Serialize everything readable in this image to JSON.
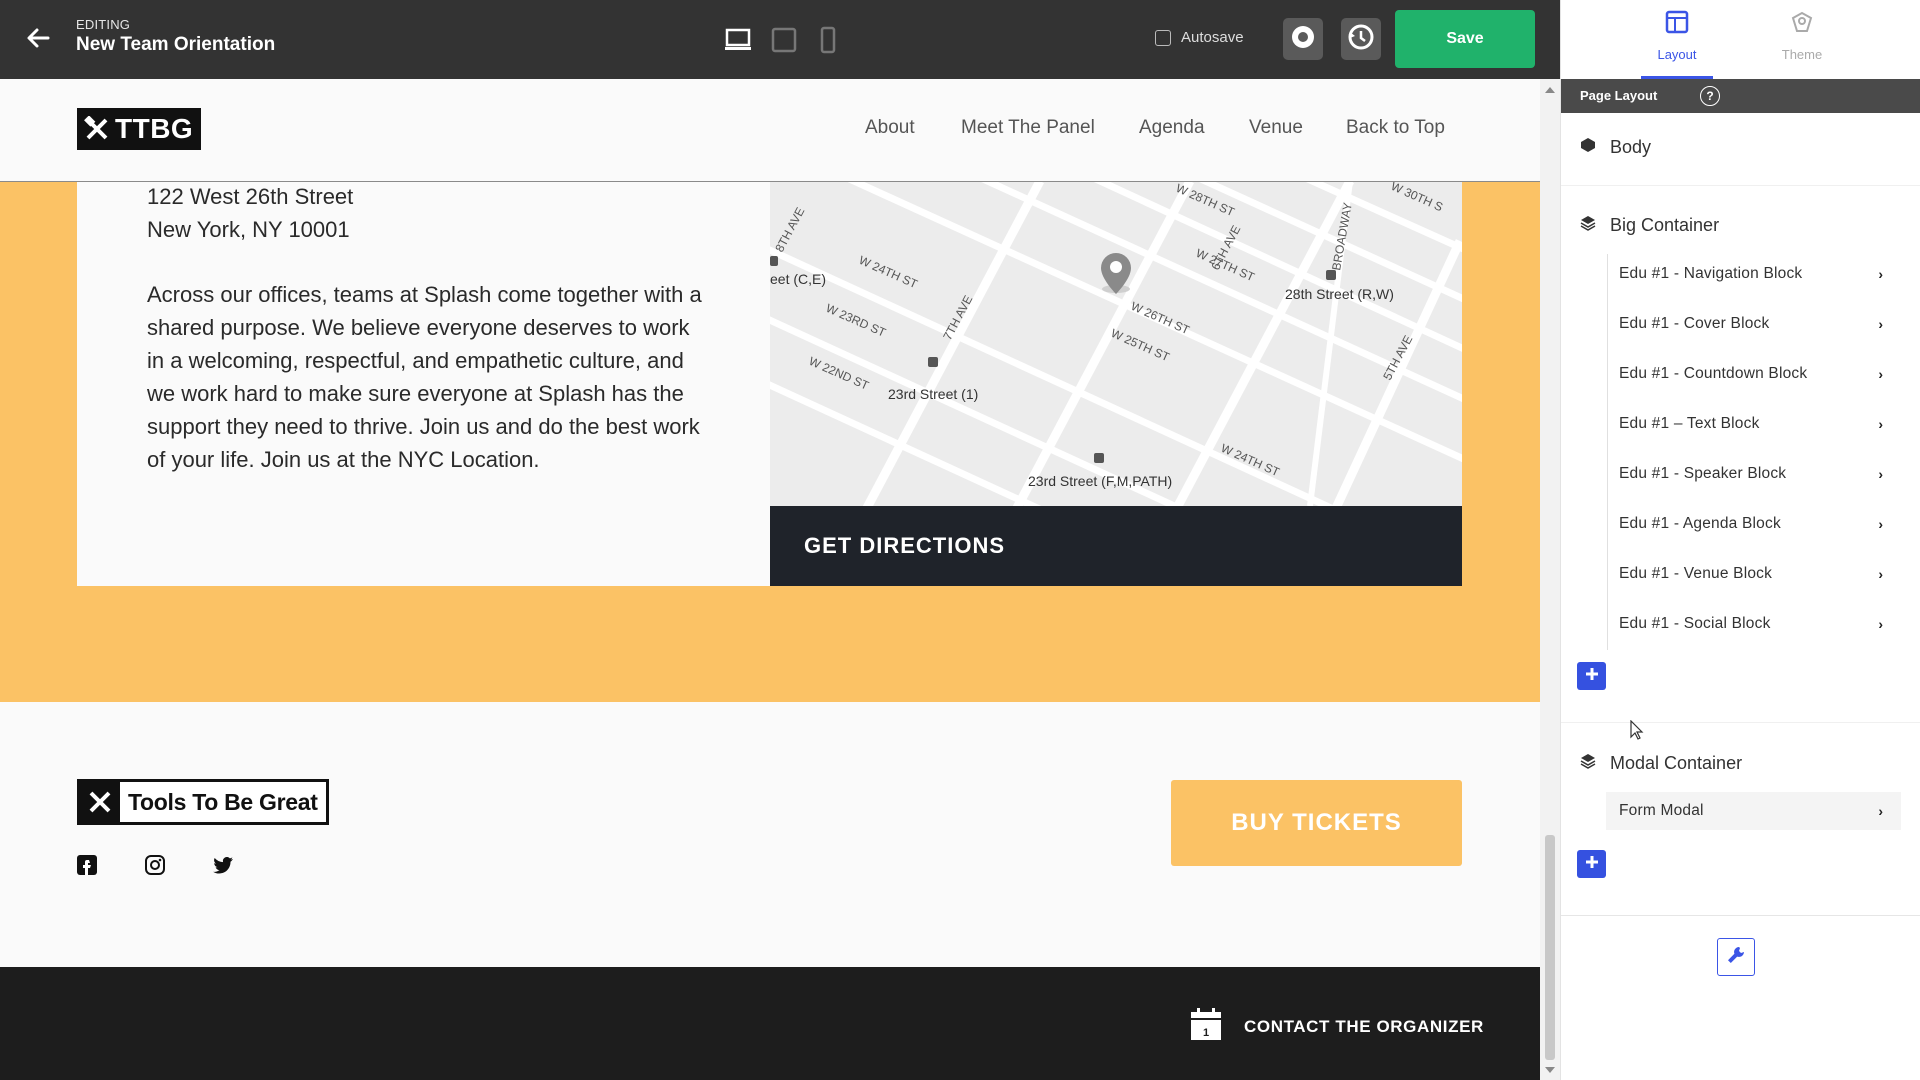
{
  "editor": {
    "editing_label": "EDITING",
    "page_name": "New Team Orientation",
    "autosave_label": "Autosave",
    "save_label": "Save"
  },
  "site": {
    "logo_text": "TTBG",
    "nav": [
      "About",
      "Meet The Panel",
      "Agenda",
      "Venue",
      "Back to Top"
    ],
    "address_line1": "122 West 26th Street",
    "address_line2": "New York, NY 10001",
    "description": "Across our offices, teams at Splash come together with a shared purpose. We believe everyone deserves to work in a welcoming, respectful, and empathetic culture, and we work hard to make sure everyone at Splash has the support they need to thrive. Join us and do the best work of your life. Join us at the NYC Location.",
    "directions_label": "GET DIRECTIONS",
    "map_labels": {
      "station_1": "23rd Street (1)",
      "station_2": "28th Street (R,W)",
      "station_3": "23rd Street (F,M,PATH)",
      "station_4": "eet (C,E)",
      "street_1": "W 24TH ST",
      "street_2": "W 23RD ST",
      "street_3": "W 22ND ST",
      "street_4": "W 26TH ST",
      "street_5": "W 25TH ST",
      "street_6": "W 27TH ST",
      "street_7": "W 28TH ST",
      "street_8": "W 24TH ST",
      "street_9": "W 30TH S",
      "avenue_1": "7TH AVE",
      "avenue_2": "6TH AVE",
      "avenue_3": "5TH AVE",
      "avenue_4": "BROADWAY",
      "avenue_5": "8TH AVE"
    },
    "footer_logo_text": "Tools To Be Great",
    "buy_label": "BUY TICKETS",
    "contact_label": "CONTACT THE ORGANIZER",
    "contact_icon_number": "1"
  },
  "panel": {
    "tabs": [
      {
        "label": "Layout",
        "icon": "layout-icon",
        "color": "#3b55e6"
      },
      {
        "label": "Theme",
        "icon": "theme-icon",
        "color": "#aaaaaa"
      }
    ],
    "page_layout_title": "Page Layout",
    "help": "?",
    "body_label": "Body",
    "big_container_label": "Big Container",
    "big_container_items": [
      "Edu #1 - Navigation Block",
      "Edu #1 - Cover Block",
      "Edu #1 - Countdown Block",
      "Edu #1 – Text Block",
      "Edu #1 - Speaker Block",
      "Edu #1 - Agenda Block",
      "Edu #1 - Venue Block",
      "Edu #1 - Social Block"
    ],
    "modal_container_label": "Modal Container",
    "modal_items": [
      "Form Modal"
    ]
  },
  "colors": {
    "accent": "#3b55e6",
    "save": "#20b26b",
    "band": "#fbc265",
    "dark": "#1f232a"
  }
}
